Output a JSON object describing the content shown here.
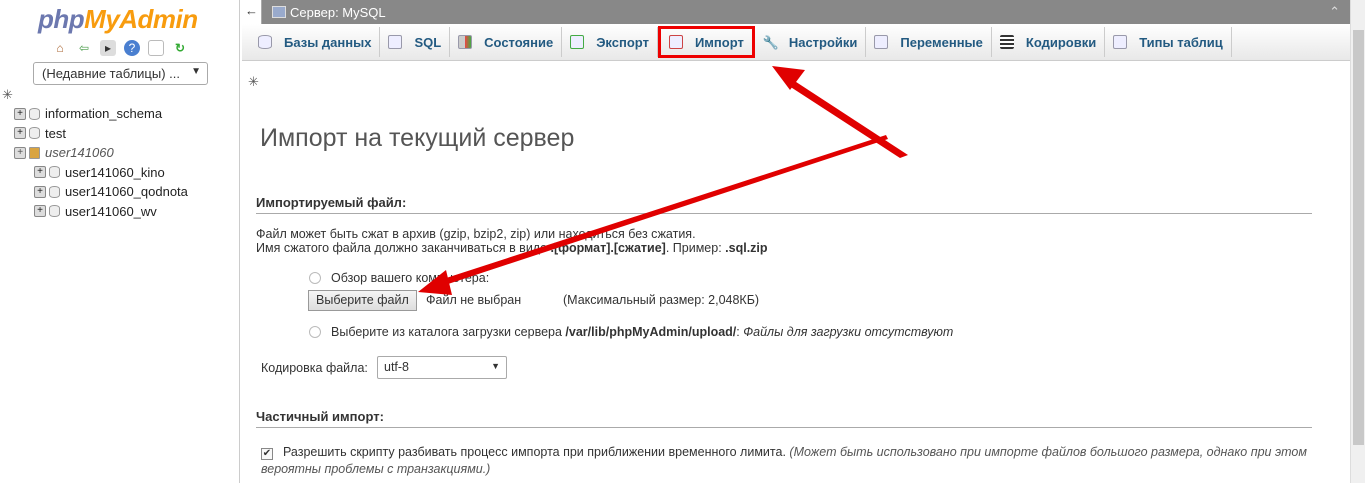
{
  "sidebar": {
    "logo": "phpMyAdmin",
    "logo_php": "php",
    "logo_mya": "MyAdmin",
    "recent_tables": "(Недавние таблицы) ...",
    "databases": [
      "information_schema",
      "test"
    ],
    "group": "user141060",
    "group_children": [
      "user141060_kino",
      "user141060_qodnota",
      "user141060_wv"
    ]
  },
  "header": {
    "back": "←",
    "server": "Сервер: MySQL"
  },
  "tabs": [
    {
      "label": "Базы данных",
      "icon": "database-icon"
    },
    {
      "label": "SQL",
      "icon": "sql-icon"
    },
    {
      "label": "Состояние",
      "icon": "status-icon"
    },
    {
      "label": "Экспорт",
      "icon": "export-icon"
    },
    {
      "label": "Импорт",
      "icon": "import-icon",
      "active": true
    },
    {
      "label": "Настройки",
      "icon": "wrench-icon"
    },
    {
      "label": "Переменные",
      "icon": "variables-icon"
    },
    {
      "label": "Кодировки",
      "icon": "charset-icon"
    },
    {
      "label": "Типы таблиц",
      "icon": "engines-icon"
    }
  ],
  "page": {
    "title": "Импорт на текущий сервер",
    "file_section": "Импортируемый файл:",
    "line1": "Файл может быть сжат в архив (gzip, bzip2, zip) или находиться без сжатия.",
    "line2_a": "Имя сжатого файла должно заканчиваться в виде ",
    "line2_b": ".[формат].[сжатие]",
    "line2_c": ". Пример: ",
    "line2_d": ".sql.zip",
    "browse_label": "Обзор вашего компьютера:",
    "choose_file": "Выберите файл",
    "no_file": "Файл не выбран",
    "max_size": "(Максимальный размер: 2,048КБ)",
    "upload_dir_a": "Выберите из каталога загрузки сервера ",
    "upload_dir_path": "/var/lib/phpMyAdmin/upload/",
    "upload_dir_c": ": ",
    "upload_dir_none": "Файлы для загрузки отсутствуют",
    "charset_label": "Кодировка файла:",
    "charset_value": "utf-8",
    "partial_section": "Частичный импорт:",
    "allow_interrupt": "Разрешить скрипту разбивать процесс импорта при приближении временного лимита.",
    "allow_interrupt_note": "(Может быть использовано при импорте файлов большого размера, однако при этом вероятны проблемы с транзакциями.)",
    "allow_interrupt_checked": true
  },
  "colors": {
    "highlight": "#e00000",
    "link": "#235a81"
  }
}
